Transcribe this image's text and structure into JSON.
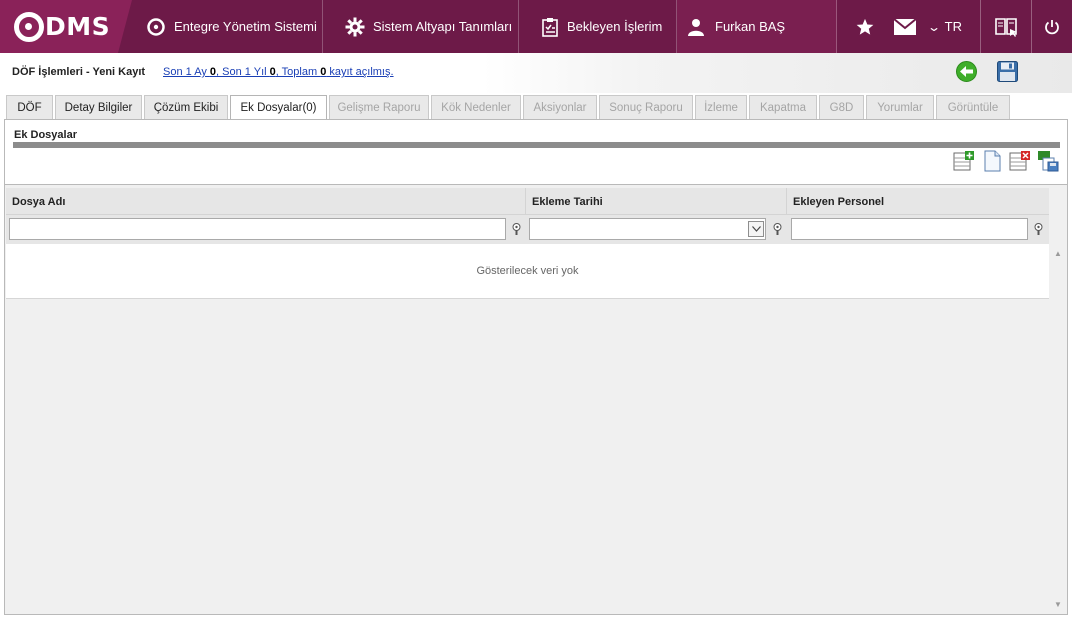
{
  "app": {
    "logo_text": "DMS"
  },
  "nav": {
    "system_label": "Entegre Yönetim Sistemi",
    "settings_label": "Sistem Altyapı Tanımları",
    "pending_label": "Bekleyen İşlerim",
    "user_label": "Furkan BAŞ",
    "lang_label": "TR"
  },
  "header": {
    "title": "DÖF İşlemleri - Yeni Kayıt",
    "stats_prefix_1": "Son 1 Ay ",
    "stats_val_1": "0",
    "stats_prefix_2": ", Son 1 Yıl ",
    "stats_val_2": "0",
    "stats_prefix_3": ", Toplam ",
    "stats_val_3": "0",
    "stats_suffix": " kayıt açılmış."
  },
  "tabs": [
    {
      "label": "DÖF",
      "state": "normal"
    },
    {
      "label": "Detay Bilgiler",
      "state": "normal"
    },
    {
      "label": "Çözüm Ekibi",
      "state": "normal"
    },
    {
      "label": "Ek Dosyalar(0)",
      "state": "active"
    },
    {
      "label": "Gelişme Raporu",
      "state": "disabled"
    },
    {
      "label": "Kök Nedenler",
      "state": "disabled"
    },
    {
      "label": "Aksiyonlar",
      "state": "disabled"
    },
    {
      "label": "Sonuç Raporu",
      "state": "disabled"
    },
    {
      "label": "İzleme",
      "state": "disabled"
    },
    {
      "label": "Kapatma",
      "state": "disabled"
    },
    {
      "label": "G8D",
      "state": "disabled"
    },
    {
      "label": "Yorumlar",
      "state": "disabled"
    },
    {
      "label": "Görüntüle",
      "state": "disabled"
    }
  ],
  "section": {
    "title": "Ek Dosyalar"
  },
  "grid": {
    "columns": [
      "Dosya Adı",
      "Ekleme Tarihi",
      "Ekleyen Personel"
    ],
    "empty_text": "Gösterilecek veri yok",
    "filters": {
      "file_name": "",
      "date": "",
      "personnel": ""
    }
  },
  "colors": {
    "topbar": "#6d1a48",
    "logo_bg": "#8a2259",
    "accent_green": "#3fae2a"
  }
}
